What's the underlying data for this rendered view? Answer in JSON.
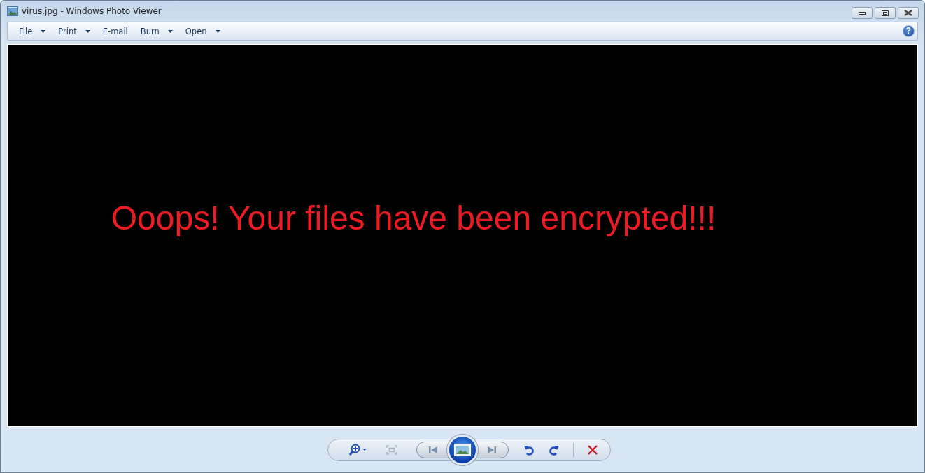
{
  "window": {
    "title": "virus.jpg - Windows Photo Viewer"
  },
  "menu": [
    {
      "label": "File",
      "dropdown": true
    },
    {
      "label": "Print",
      "dropdown": true
    },
    {
      "label": "E-mail",
      "dropdown": false
    },
    {
      "label": "Burn",
      "dropdown": true
    },
    {
      "label": "Open",
      "dropdown": true
    }
  ],
  "help": "?",
  "image": {
    "text": "Ooops! Your files have been encrypted!!!"
  },
  "toolbar": [
    {
      "kind": "zoom",
      "disabled": false
    },
    {
      "kind": "fit",
      "disabled": true
    },
    {
      "kind": "previous",
      "disabled": false
    },
    {
      "kind": "slideshow",
      "disabled": false
    },
    {
      "kind": "next",
      "disabled": false
    },
    {
      "kind": "rotate-left",
      "disabled": false
    },
    {
      "kind": "rotate-right",
      "disabled": false
    },
    {
      "kind": "delete",
      "disabled": false
    }
  ]
}
